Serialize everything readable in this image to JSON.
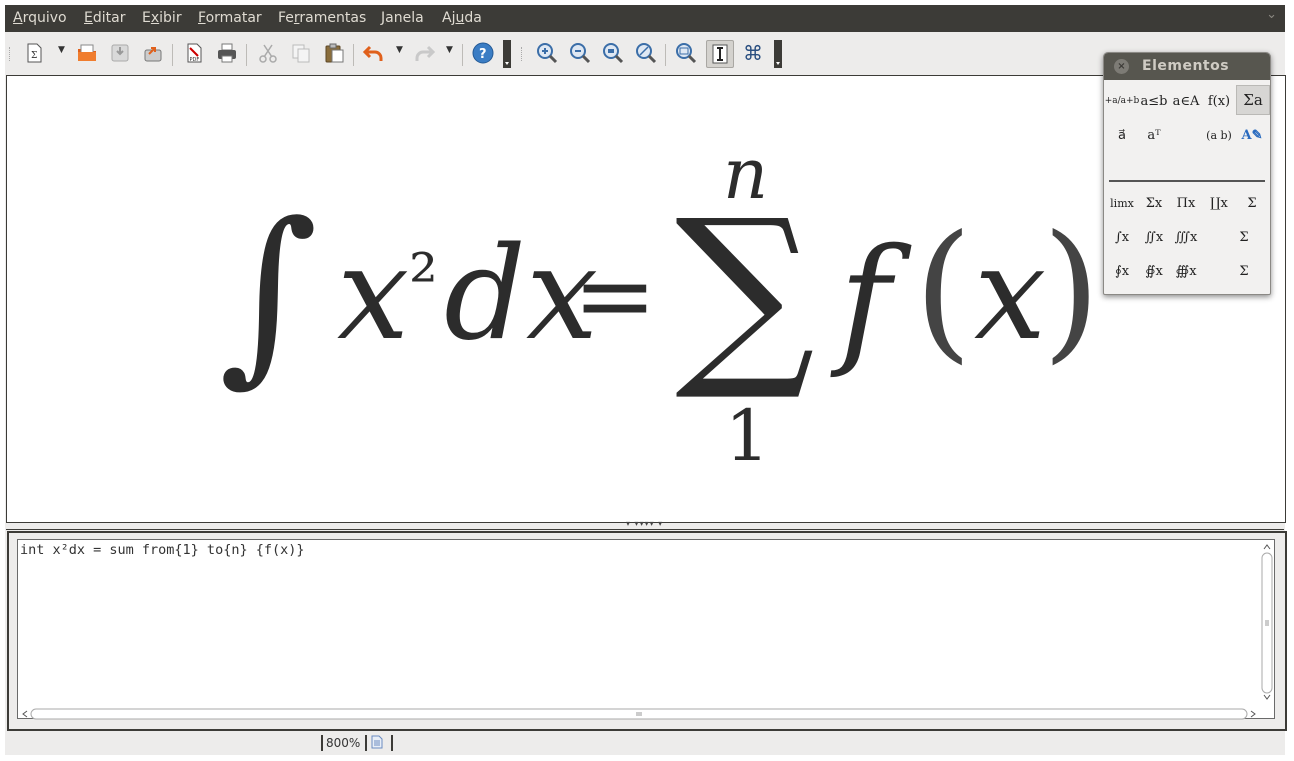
{
  "menu": {
    "items": [
      {
        "pre": "",
        "ul": "A",
        "post": "rquivo"
      },
      {
        "pre": "",
        "ul": "E",
        "post": "ditar"
      },
      {
        "pre": "E",
        "ul": "x",
        "post": "ibir"
      },
      {
        "pre": "",
        "ul": "F",
        "post": "ormatar"
      },
      {
        "pre": "Fe",
        "ul": "r",
        "post": "ramentas"
      },
      {
        "pre": "",
        "ul": "J",
        "post": "anela"
      },
      {
        "pre": "Aj",
        "ul": "u",
        "post": "da"
      }
    ]
  },
  "toolbar": {
    "icons": [
      "new-document-icon",
      "open-folder-icon",
      "save-icon",
      "export-icon",
      "export-pdf-icon",
      "print-icon",
      "cut-icon",
      "copy-icon",
      "paste-icon",
      "undo-icon",
      "redo-icon",
      "help-icon",
      "zoom-in-icon",
      "zoom-out-icon",
      "zoom-100-icon",
      "zoom-fit-icon",
      "show-all-icon",
      "formula-cursor-icon",
      "symbols-icon"
    ],
    "pdf_label": "PDF",
    "help_glyph": "?",
    "symbols_glyph": "⌘"
  },
  "formula": {
    "integral": "∫",
    "x": "x",
    "sq": "²",
    "dx": "dx",
    "eq": "=",
    "sum": "∑",
    "upper": "n",
    "lower": "1",
    "f": "f",
    "lparen": "(",
    "arg": "x",
    "rparen": ")"
  },
  "command": {
    "text": "int x²dx = sum from{1} to{n} {f(x)}"
  },
  "status": {
    "zoom": "800%"
  },
  "elements_panel": {
    "title": "Elementos",
    "close_glyph": "×",
    "category_row1": [
      "+a/a+b",
      "a≤b",
      "a∈A",
      "f(x)",
      "Σa"
    ],
    "category_row2": [
      "a⃗",
      "aᵀ",
      "",
      "(a b)",
      "A✎"
    ],
    "op_row1": [
      "limx",
      "Σx",
      "Πx",
      "∐x",
      "Σ"
    ],
    "op_row2": [
      "∫x",
      "∬x",
      "∭x",
      "",
      "Σ"
    ],
    "op_row3": [
      "∮x",
      "∯x",
      "∰x",
      "",
      "Σ"
    ],
    "selected_category": "Σa"
  }
}
